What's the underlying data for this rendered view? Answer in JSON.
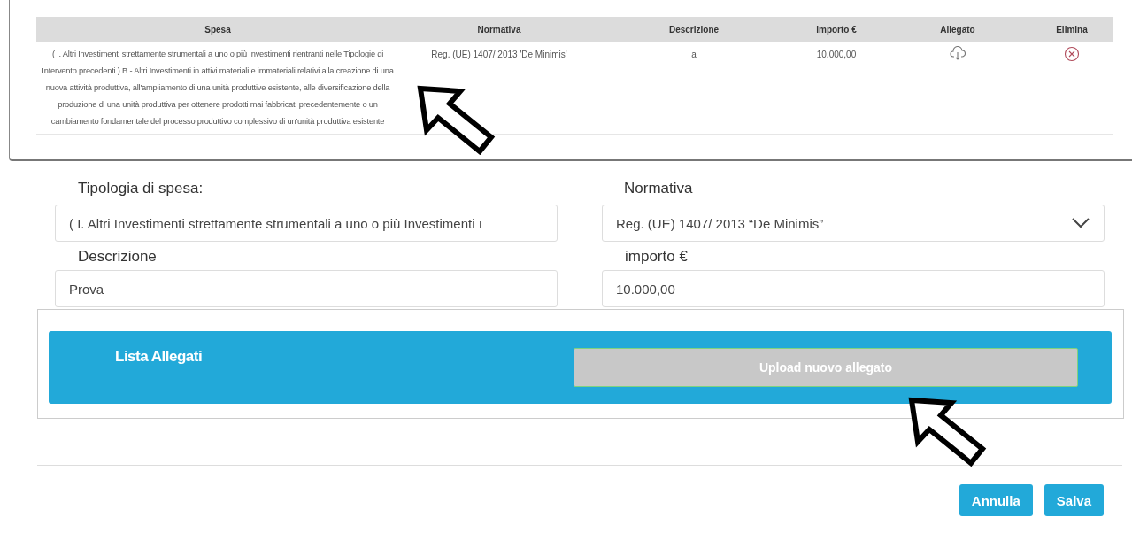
{
  "table": {
    "columns": [
      "Spesa",
      "Normativa",
      "Descrizione",
      "importo €",
      "Allegato",
      "Elimina"
    ],
    "rows": [
      {
        "spesa": "( I. Altri Investimenti strettamente strumentali a uno o più Investimenti rientranti nelle Tipologie di Intervento precedenti ) B - Altri Investimenti in attivi materiali e immateriali relativi alla creazione di una nuova attività produttiva, all'ampliamento di una unità produttive esistente, alle diversificazione della produzione di una unità produttiva per ottenere prodotti mai fabbricati precedentemente o un cambiamento fondamentale del processo produttivo complessivo di un'unità produttiva esistente",
        "normativa": "Reg. (UE) 1407/ 2013 'De Minimis'",
        "descrizione": "a",
        "importo": "10.000,00"
      }
    ]
  },
  "form": {
    "fields": [
      {
        "label": "Tipologia di spesa:",
        "kind": "text",
        "value": "( I. Altri Investimenti strettamente strumentali a uno o più Investimenti ı"
      },
      {
        "label": "Normativa",
        "kind": "select",
        "value": "Reg. (UE) 1407/ 2013 “De Minimis”"
      },
      {
        "label": "Descrizione",
        "kind": "text",
        "value": "Prova"
      },
      {
        "label": "importo €",
        "kind": "text",
        "value": "10.000,00"
      }
    ]
  },
  "attachments": {
    "title": "Lista Allegati",
    "upload_button": {
      "label": "Upload nuovo allegato",
      "disabled": true
    }
  },
  "buttons": [
    "Annulla",
    "Salva"
  ]
}
